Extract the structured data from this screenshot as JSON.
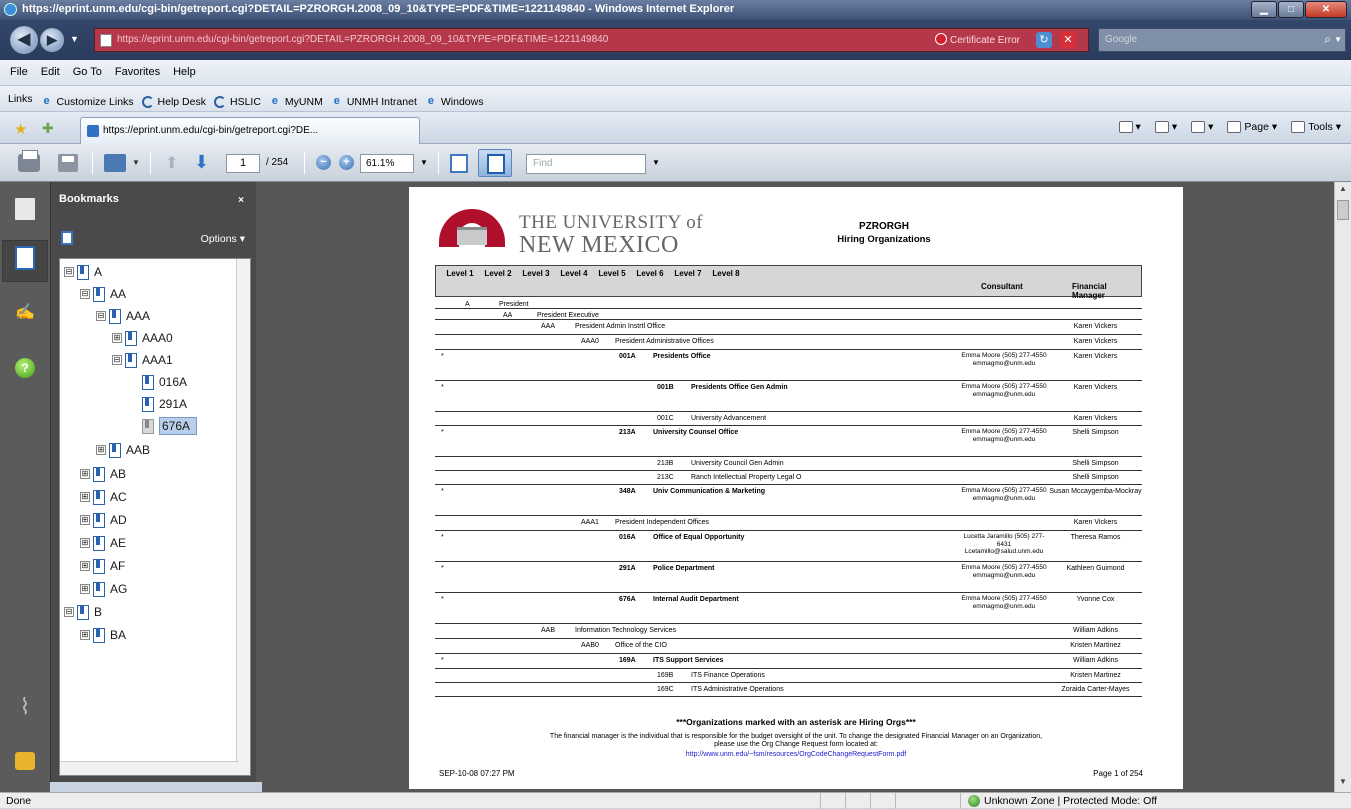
{
  "window": {
    "title": "https://eprint.unm.edu/cgi-bin/getreport.cgi?DETAIL=PZRORGH.2008_09_10&TYPE=PDF&TIME=1221149840 - Windows Internet Explorer"
  },
  "address": {
    "url": "https://eprint.unm.edu/cgi-bin/getreport.cgi?DETAIL=PZRORGH.2008_09_10&TYPE=PDF&TIME=1221149840",
    "cert_error": "Certificate Error",
    "search_placeholder": "Google"
  },
  "menu": [
    "File",
    "Edit",
    "Go To",
    "Favorites",
    "Help"
  ],
  "links": {
    "label": "Links",
    "items": [
      "Customize Links",
      "Help Desk",
      "HSLIC",
      "MyUNM",
      "UNMH Intranet",
      "Windows"
    ]
  },
  "tab": {
    "title": "https://eprint.unm.edu/cgi-bin/getreport.cgi?DE..."
  },
  "commandbar": {
    "page": "Page",
    "tools": "Tools"
  },
  "pdf_toolbar": {
    "current_page": "1",
    "total_pages": "/ 254",
    "zoom": "61.1%",
    "find_placeholder": "Find"
  },
  "bookmarks": {
    "title": "Bookmarks",
    "close": "×",
    "options": "Options ▾",
    "tree": [
      {
        "label": "A",
        "exp": "⊟"
      },
      {
        "label": "AA",
        "exp": "⊟"
      },
      {
        "label": "AAA",
        "exp": "⊟"
      },
      {
        "label": "AAA0",
        "exp": "⊞"
      },
      {
        "label": "AAA1",
        "exp": "⊟"
      },
      {
        "label": "016A",
        "exp": ""
      },
      {
        "label": "291A",
        "exp": ""
      },
      {
        "label": "676A",
        "exp": ""
      },
      {
        "label": "AAB",
        "exp": "⊞"
      },
      {
        "label": "AB",
        "exp": "⊞"
      },
      {
        "label": "AC",
        "exp": "⊞"
      },
      {
        "label": "AD",
        "exp": "⊞"
      },
      {
        "label": "AE",
        "exp": "⊞"
      },
      {
        "label": "AF",
        "exp": "⊞"
      },
      {
        "label": "AG",
        "exp": "⊞"
      },
      {
        "label": "B",
        "exp": "⊟"
      },
      {
        "label": "BA",
        "exp": "⊞"
      }
    ]
  },
  "report": {
    "logo_line1": "THE UNIVERSITY of",
    "logo_line2": "NEW MEXICO",
    "code": "PZRORGH",
    "subtitle": "Hiring Organizations",
    "headers": {
      "levels": [
        "Level 1",
        "Level 2",
        "Level 3",
        "Level 4",
        "Level 5",
        "Level 6",
        "Level 7",
        "Level 8"
      ],
      "consultant": "Consultant",
      "financial_manager": "Financial Manager"
    },
    "rows": [
      {
        "ast": "",
        "code": "A",
        "name": "President",
        "cons": "",
        "fm": ""
      },
      {
        "ast": "",
        "code": "AA",
        "name": "President Executive",
        "cons": "",
        "fm": ""
      },
      {
        "ast": "",
        "code": "AAA",
        "name": "President Admin Instrtl Office",
        "cons": "",
        "fm": "Karen Vickers"
      },
      {
        "ast": "",
        "code": "AAA0",
        "name": "President Administrative Offices",
        "cons": "",
        "fm": "Karen Vickers"
      },
      {
        "ast": "*",
        "code": "001A",
        "name": "Presidents Office",
        "cons": "Emma Moore (505) 277-4550 emmagmo@unm.edu",
        "fm": "Karen Vickers"
      },
      {
        "ast": "*",
        "code": "001B",
        "name": "Presidents Office Gen Admin",
        "cons": "Emma Moore (505) 277-4550 emmagmo@unm.edu",
        "fm": "Karen Vickers"
      },
      {
        "ast": "",
        "code": "001C",
        "name": "University Advancement",
        "cons": "",
        "fm": "Karen Vickers"
      },
      {
        "ast": "*",
        "code": "213A",
        "name": "University Counsel Office",
        "cons": "Emma Moore (505) 277-4550 emmagmo@unm.edu",
        "fm": "Shelli Simpson"
      },
      {
        "ast": "",
        "code": "213B",
        "name": "University Council Gen Admin",
        "cons": "",
        "fm": "Shelli Simpson"
      },
      {
        "ast": "",
        "code": "213C",
        "name": "Ranch Intellectual Property Legal O",
        "cons": "",
        "fm": "Shelli Simpson"
      },
      {
        "ast": "*",
        "code": "348A",
        "name": "Univ Communication & Marketing",
        "cons": "Emma Moore (505) 277-4550 emmagmo@unm.edu",
        "fm": "Susan Mccaygemba-Mockray"
      },
      {
        "ast": "",
        "code": "AAA1",
        "name": "President Independent Offices",
        "cons": "",
        "fm": "Karen Vickers"
      },
      {
        "ast": "*",
        "code": "016A",
        "name": "Office of Equal Opportunity",
        "cons": "Lucetta Jaramillo (505) 277-6431 Lcetamillo@salud.unm.edu",
        "fm": "Theresa Ramos"
      },
      {
        "ast": "*",
        "code": "291A",
        "name": "Police Department",
        "cons": "Emma Moore (505) 277-4550 emmagmo@unm.edu",
        "fm": "Kathleen Guimond"
      },
      {
        "ast": "*",
        "code": "676A",
        "name": "Internal Audit Department",
        "cons": "Emma Moore (505) 277-4550 emmagmo@unm.edu",
        "fm": "Yvonne Cox"
      },
      {
        "ast": "",
        "code": "AAB",
        "name": "Information Technology Services",
        "cons": "",
        "fm": "William Adkins"
      },
      {
        "ast": "",
        "code": "AAB0",
        "name": "Office of the CIO",
        "cons": "",
        "fm": "Kristen Martinez"
      },
      {
        "ast": "*",
        "code": "169A",
        "name": "ITS Support Services",
        "cons": "",
        "fm": "William Adkins"
      },
      {
        "ast": "",
        "code": "169B",
        "name": "ITS Finance Operations",
        "cons": "",
        "fm": "Kristen Martinez"
      },
      {
        "ast": "",
        "code": "169C",
        "name": "ITS Administrative Operations",
        "cons": "",
        "fm": "Zoraida Carter-Mayes"
      }
    ],
    "footnote_bold": "***Organizations marked with an asterisk are Hiring Orgs***",
    "footnote_text": "The financial manager is the individual that is responsible for the budget oversight of the unit. To change the designated Financial Manager on an Organization, please use the Org Change Request form located at:",
    "footnote_link": "http://www.unm.edu/~fsm/resources/OrgCodeChangeRequestForm.pdf",
    "date": "SEP-10-08 07:27 PM",
    "page_of": "Page 1 of 254"
  },
  "status": {
    "left": "Done",
    "zone": "Unknown Zone | Protected Mode: Off"
  }
}
